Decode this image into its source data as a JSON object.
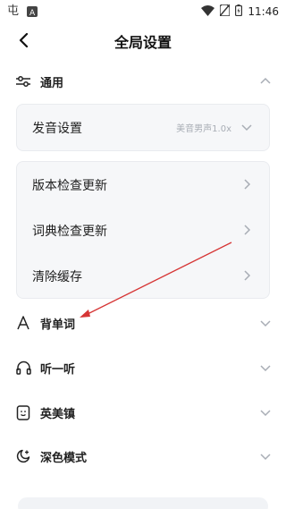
{
  "status_bar": {
    "time": "11:46"
  },
  "header": {
    "title": "全局设置"
  },
  "sections": {
    "general": {
      "label": "通用"
    },
    "pronunciation": {
      "label": "发音设置",
      "value": "美音男声1.0x"
    },
    "version_check": {
      "label": "版本检查更新"
    },
    "dict_check": {
      "label": "词典检查更新"
    },
    "clear_cache": {
      "label": "清除缓存"
    },
    "vocab": {
      "label": "背单词"
    },
    "listen": {
      "label": "听一听"
    },
    "english_town": {
      "label": "英美镇"
    },
    "dark_mode": {
      "label": "深色模式"
    }
  },
  "colors": {
    "annotation_arrow": "#d63535",
    "card_bg": "#f6f7f9",
    "chevron": "#a8adb5"
  }
}
